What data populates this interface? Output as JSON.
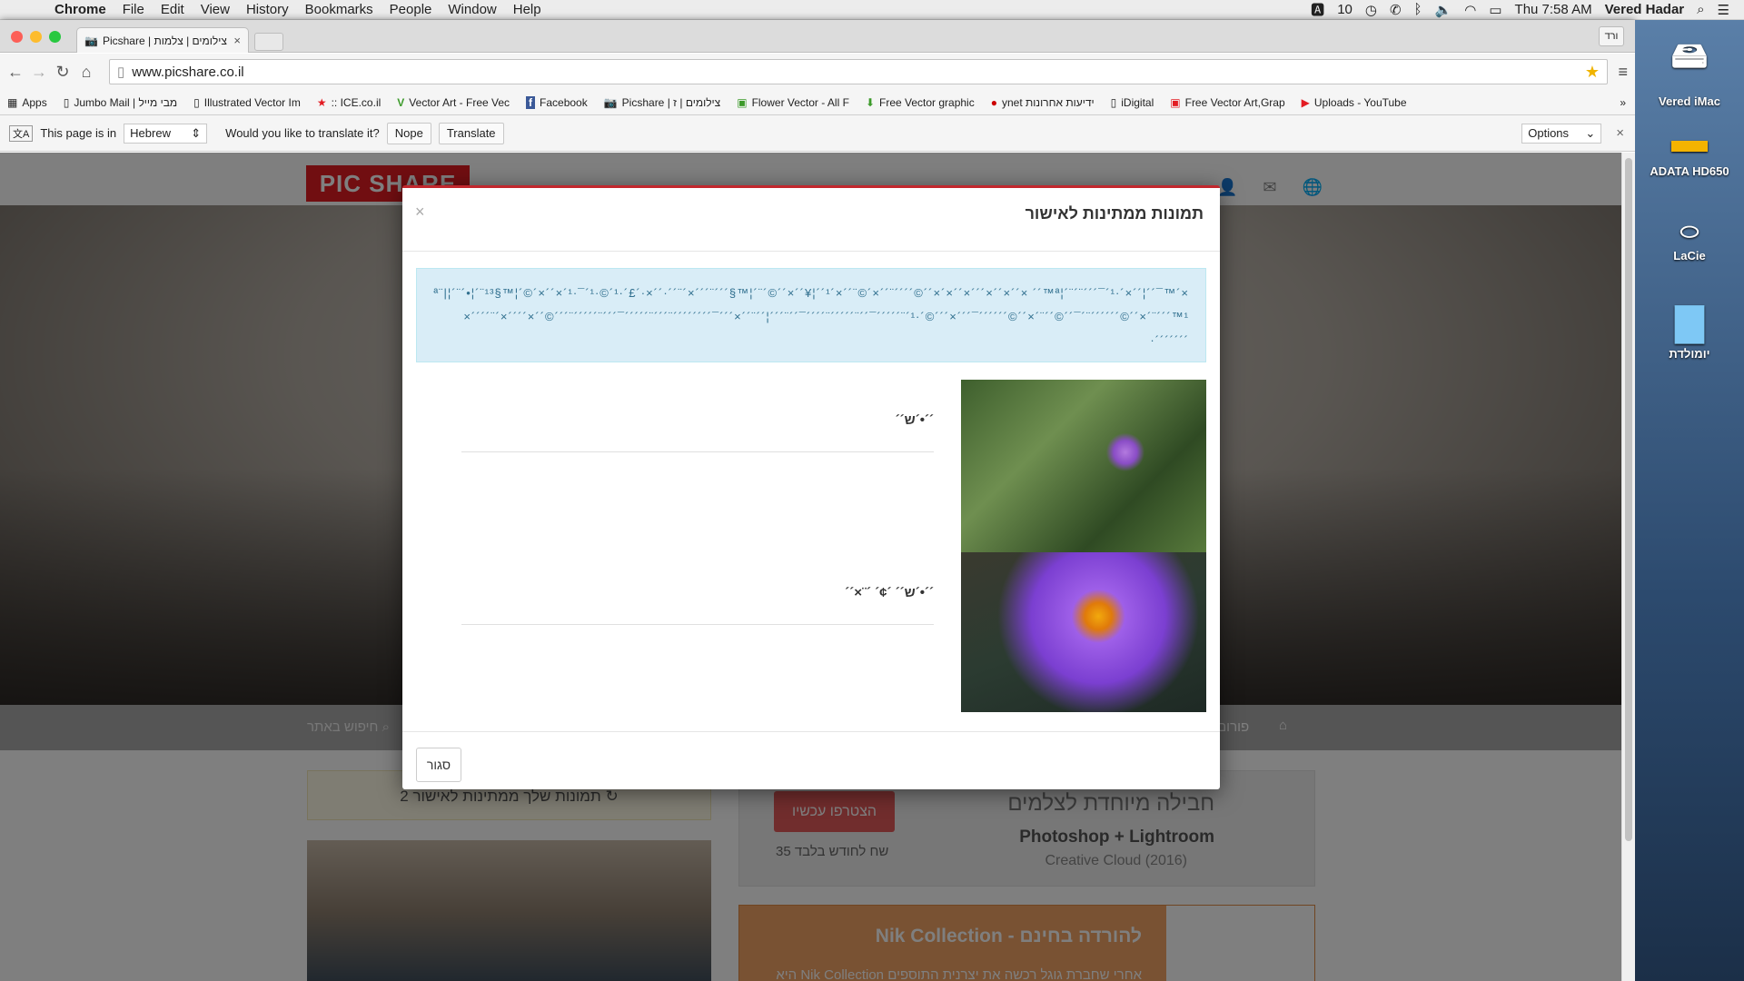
{
  "menubar": {
    "app": "Chrome",
    "items": [
      "File",
      "Edit",
      "View",
      "History",
      "Bookmarks",
      "People",
      "Window",
      "Help"
    ],
    "status_count": "10",
    "clock": "Thu 7:58 AM",
    "user": "Vered Hadar"
  },
  "browser": {
    "tab_title": "Picshare | צילומים | צלמות",
    "tab_close": "×",
    "profile": "ורד",
    "url": "www.picshare.co.il",
    "bookmarks": [
      {
        "label": "Apps",
        "icon": "apps-icon"
      },
      {
        "label": "Jumbo Mail | מבי מייל",
        "icon": "page-icon"
      },
      {
        "label": "Illustrated Vector Im",
        "icon": "page-icon"
      },
      {
        "label": ":: ICE.co.il",
        "icon": "ice-icon"
      },
      {
        "label": "Vector Art - Free Vec",
        "icon": "vector-icon"
      },
      {
        "label": "Facebook",
        "icon": "facebook-icon"
      },
      {
        "label": "Picshare | צילומים | ז",
        "icon": "camera-icon"
      },
      {
        "label": "Flower Vector - All F",
        "icon": "page-icon"
      },
      {
        "label": "Free Vector graphic",
        "icon": "download-icon"
      },
      {
        "label": "ynet ידיעות אחרונות",
        "icon": "ynet-icon"
      },
      {
        "label": "iDigital",
        "icon": "page-icon"
      },
      {
        "label": "Free Vector Art,Grap",
        "icon": "page-icon"
      },
      {
        "label": "Uploads - YouTube",
        "icon": "youtube-icon"
      }
    ],
    "more_bookmarks": "»"
  },
  "translate": {
    "prefix": "This page is in",
    "language": "Hebrew",
    "question": "Would you like to translate it?",
    "nope": "Nope",
    "translate": "Translate",
    "options": "Options",
    "close": "×"
  },
  "site": {
    "logo": "PIC SHARE",
    "search": "חיפוש באתר",
    "forum": "פורום",
    "pending": "2 תמונות שלך ממתינות לאישור",
    "promo": {
      "join": "הצטרפו עכשיו",
      "price": "35 שח לחודש בלבד",
      "title": "חבילה מיוחדת לצלמים",
      "product": "Photoshop + Lightroom",
      "version": "Creative Cloud (2016)"
    },
    "nik": {
      "title": "Nik Collection - להורדה בחינם",
      "desc": "אחרי שחברת גוגל רכשה את יצרנית התוספים Nik Collection היא"
    }
  },
  "modal": {
    "title": "תמונות ממתינות לאישור",
    "close_x": "×",
    "notice": "×´™ª¨|¦´¨´•¦´¨¹³§™¦´©´×´´×´¹·¯´¹·©´¹·´£´·×´´·´´¨´×´´´¨´´´§™¦´¨´©´´×´´¥¦´´¹´×´´¨©´×´´¨´´´´©´´×´×´´×´´´×´´×´´× ´´™ª¦´¨´¨´´´¯´¹·´×´´¦´´¯´´´¨´´¯´´´´¨´´´´´¨´´¯´´´´´¨´¹·´©´´´×´´´¯´´´´´´©´´×´¨´´©´´¯´¨´´´´´´©´´×´¨´´´™¹¦´´¨´´×´´´¯´´´´´´´´¨´´´¨´´´´´¯´´´¨´´´´´¨´´´©´´×´´´´×´¨´´´´×´´´´´´´·",
    "photos": [
      {
        "caption": "´´•´ש´´"
      },
      {
        "caption": "´´•´ש´´ ´¢´ ´¨×´´"
      }
    ],
    "close": "סגור"
  },
  "desktop": {
    "icons": [
      "Vered iMac",
      "ADATA HD650",
      "LaCie",
      "יומולדת"
    ]
  },
  "colors": {
    "brand_red": "#e31c23",
    "modal_accent": "#c2272d",
    "notice_bg": "#d9edf7",
    "promo_button": "#e35b5b",
    "nik_orange": "#f2a566"
  }
}
